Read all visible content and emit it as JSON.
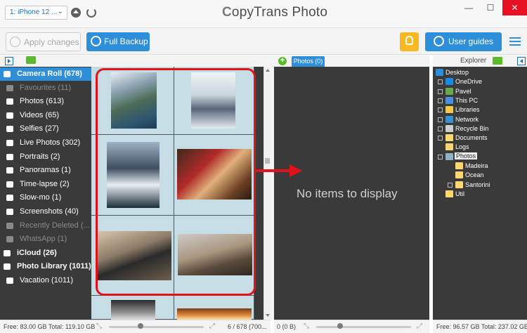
{
  "titlebar": {
    "device": "1: iPhone 12 ...",
    "app_title_logo": "C",
    "app_title": "opyTrans Photo",
    "minimize": "—",
    "maximize": "☐",
    "close": "✕"
  },
  "toolbar": {
    "apply_label": "Apply changes",
    "backup_label": "Full Backup",
    "guides_label": "User guides"
  },
  "subheader": {
    "photos_tab": "Photos (0)",
    "explorer_label": "Explorer"
  },
  "sidebar": {
    "items": [
      {
        "label": "Camera Roll (678)",
        "icon": "camera-roll-icon",
        "state": "selected"
      },
      {
        "label": "Favourites (11)",
        "icon": "heart-icon",
        "state": "dim"
      },
      {
        "label": "Photos (613)",
        "icon": "camera-icon",
        "state": "normal"
      },
      {
        "label": "Videos (65)",
        "icon": "video-icon",
        "state": "normal"
      },
      {
        "label": "Selfies (27)",
        "icon": "selfie-icon",
        "state": "normal"
      },
      {
        "label": "Live Photos (302)",
        "icon": "live-photo-icon",
        "state": "normal"
      },
      {
        "label": "Portraits (2)",
        "icon": "portrait-icon",
        "state": "normal"
      },
      {
        "label": "Panoramas (1)",
        "icon": "panorama-icon",
        "state": "normal"
      },
      {
        "label": "Time-lapse (2)",
        "icon": "timelapse-icon",
        "state": "normal"
      },
      {
        "label": "Slow-mo (1)",
        "icon": "slowmo-icon",
        "state": "normal"
      },
      {
        "label": "Screenshots (40)",
        "icon": "screenshot-icon",
        "state": "normal"
      },
      {
        "label": "Recently Deleted (...",
        "icon": "trash-icon",
        "state": "dim"
      },
      {
        "label": "WhatsApp (1)",
        "icon": "album-icon",
        "state": "dim"
      },
      {
        "label": "iCloud (26)",
        "icon": "cloud-icon",
        "state": "bold"
      },
      {
        "label": "Photo Library (1011)",
        "icon": "camera-icon",
        "state": "bold"
      },
      {
        "label": "Vacation (1011)",
        "icon": "album-icon",
        "state": "normal"
      }
    ]
  },
  "middle": {
    "empty_message": "No items to display"
  },
  "tree": {
    "items": [
      {
        "label": "Desktop",
        "icon": "desktop-icon",
        "color": "#2e8fd8"
      },
      {
        "label": "OneDrive",
        "icon": "onedrive-icon",
        "color": "#1e88e5"
      },
      {
        "label": "Pavel",
        "icon": "user-folder-icon",
        "color": "#6aa84f"
      },
      {
        "label": "This PC",
        "icon": "computer-icon",
        "color": "#4a90d9"
      },
      {
        "label": "Libraries",
        "icon": "libraries-icon",
        "color": "#f2c94c"
      },
      {
        "label": "Network",
        "icon": "network-icon",
        "color": "#3d8fd1"
      },
      {
        "label": "Recycle Bin",
        "icon": "recycle-bin-icon",
        "color": "#cfcfcf"
      },
      {
        "label": "Documents",
        "icon": "folder-icon",
        "color": "#f8d774"
      },
      {
        "label": "Logs",
        "icon": "folder-icon",
        "color": "#f8d774"
      },
      {
        "label": "Photos",
        "icon": "folder-icon",
        "color": "#8fb3c3"
      },
      {
        "label": "Madeira",
        "icon": "folder-icon",
        "color": "#f8d774"
      },
      {
        "label": "Ocean",
        "icon": "folder-icon",
        "color": "#f8d774"
      },
      {
        "label": "Santorini",
        "icon": "folder-icon",
        "color": "#f8d774"
      },
      {
        "label": "Util",
        "icon": "folder-icon",
        "color": "#f8d774"
      }
    ]
  },
  "status": {
    "left_free": "Free: 83.00 GB Total: 119.10 GB",
    "left_count": "6 / 678 (700...",
    "mid_count": "0 (0 B)",
    "right_free": "Free: 96.57 GB Total: 237.02 GB"
  },
  "colors": {
    "accent": "#2e8fd8",
    "highlight_red": "#e0121a",
    "pane_bg": "#3a3a3a"
  }
}
